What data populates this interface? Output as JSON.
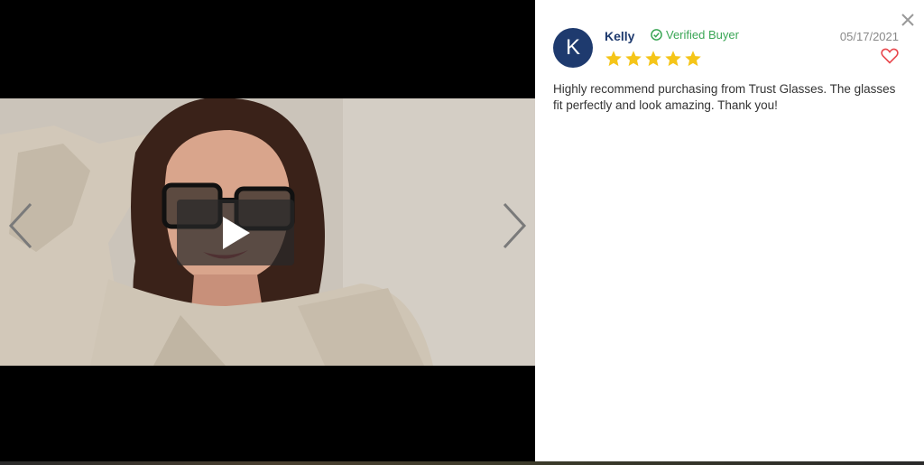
{
  "review": {
    "avatar_letter": "K",
    "author": "Kelly",
    "verified_label": "Verified Buyer",
    "date": "05/17/2021",
    "rating": 5,
    "text": "Highly recommend purchasing from Trust Glasses. The glasses fit perfectly and look amazing. Thank you!"
  },
  "colors": {
    "brand_navy": "#1e3a6e",
    "verified_green": "#3aa655",
    "star_yellow": "#f5c518",
    "heart_red": "#e8474d"
  },
  "icons": [
    "chevron-left-icon",
    "chevron-right-icon",
    "play-icon",
    "close-icon",
    "check-circle-icon",
    "star-icon",
    "heart-icon"
  ]
}
